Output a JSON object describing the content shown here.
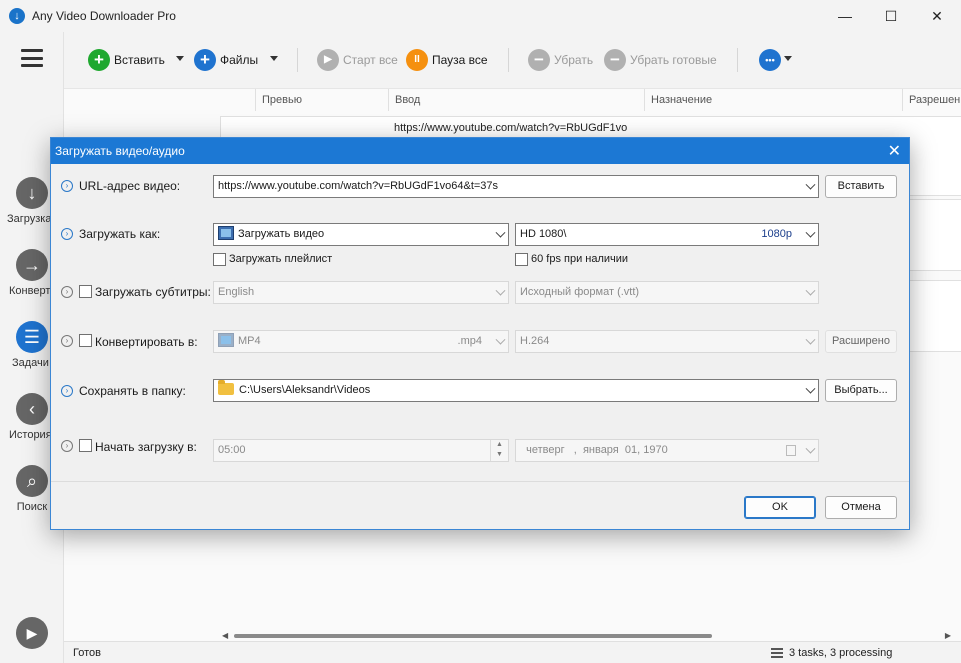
{
  "window": {
    "title": "Any Video Downloader Pro",
    "icon_label": "↓",
    "minimize": "—",
    "maximize": "☐",
    "close": "✕"
  },
  "sidebar": {
    "items": [
      {
        "label": "Загрузка",
        "icon": "download-icon",
        "glyph": "↓"
      },
      {
        "label": "Конвертер",
        "icon": "convert-icon",
        "glyph": "→"
      },
      {
        "label": "Задачи",
        "icon": "tasks-icon",
        "glyph": "☰"
      },
      {
        "label": "История",
        "icon": "history-icon",
        "glyph": "‹"
      },
      {
        "label": "Поиск",
        "icon": "search-icon",
        "glyph": "⌕"
      }
    ],
    "play_glyph": "▶"
  },
  "toolbar": {
    "paste_label": "Вставить",
    "files_label": "Файлы",
    "start_all_label": "Старт все",
    "pause_all_label": "Пауза все",
    "remove_label": "Убрать",
    "remove_done_label": "Убрать готовые",
    "plus_glyph": "+",
    "pause_glyph": "II",
    "play_glyph": "▶",
    "minus_glyph": "−",
    "more_glyph": "•••",
    "colors": {
      "green": "#1fa82f",
      "blue": "#1f73cf",
      "orange": "#f5900f",
      "gray": "#b0b0b0"
    }
  },
  "grid": {
    "columns": [
      "Превью",
      "Ввод",
      "Назначение",
      "Разрешение"
    ],
    "rows": [
      {
        "url": "https://www.youtube.com/watch?v=RbUGdF1vo"
      }
    ]
  },
  "status": {
    "left": "Готов",
    "right": "3 tasks, 3 processing"
  },
  "dialog": {
    "title": "Загружать видео/аудио",
    "close": "✕",
    "url_label": "URL-адрес видео:",
    "url_value": "https://www.youtube.com/watch?v=RbUGdF1vo64&t=37s",
    "paste_button": "Вставить",
    "download_as_label": "Загружать как:",
    "download_as_value": "Загружать видео",
    "quality_value": "HD 1080\\",
    "quality_badge": "1080p",
    "playlist_label": "Загружать плейлист",
    "fps_label": "60 fps при наличии",
    "subtitles_label": "Загружать субтитры:",
    "subtitles_lang": "English",
    "subtitles_format": "Исходный формат (.vtt)",
    "convert_label": "Конвертировать в:",
    "convert_format": "MP4",
    "convert_ext": ".mp4",
    "convert_codec": "H.264",
    "advanced_button": "Расширено",
    "save_label": "Сохранять в папку:",
    "save_path": "C:\\Users\\Aleksandr\\Videos",
    "browse_button": "Выбрать...",
    "start_label": "Начать загрузку в:",
    "start_time": "05:00",
    "start_date": "  четверг   ,  января  01, 1970",
    "ok_button": "OK",
    "cancel_button": "Отмена",
    "q_glyph": "›",
    "accent": "#1c78d4"
  }
}
